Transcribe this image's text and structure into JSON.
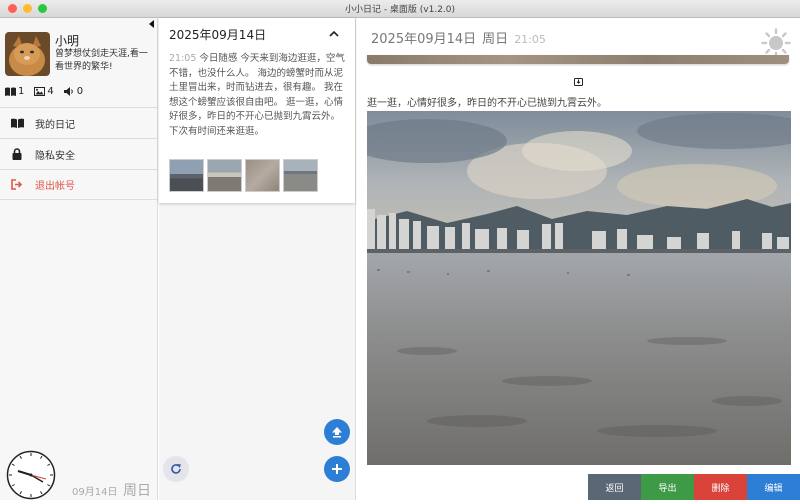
{
  "window": {
    "title": "小小日记 - 桌面版 (v1.2.0)"
  },
  "profile": {
    "name": "小明",
    "motto": "曾梦想仗剑走天涯,看一看世界的繁华!"
  },
  "stats": {
    "diaries": "1",
    "photos": "4",
    "audio": "0"
  },
  "menu": {
    "my_diary": "我的日记",
    "privacy": "隐私安全",
    "logout": "退出帐号"
  },
  "footer": {
    "date": "09月14日",
    "weekday": "周日"
  },
  "list": {
    "entry_date": "2025年09月14日",
    "entry_time": "21:05",
    "entry_text": "今日随感 今天来到海边逛逛，空气不错，也没什么人。 海边的螃蟹时而从泥土里冒出来，时而钻进去，很有趣。 我在想这个螃蟹应该很自由吧。 逛一逛，心情好很多，昨日的不开心已抛到九霄云外。 下次有时间还来逛逛。"
  },
  "detail": {
    "date": "2025年09月14日",
    "weekday": "周日",
    "time": "21:05",
    "text": "逛一逛，心情好很多，昨日的不开心已抛到九霄云外。"
  },
  "actions": {
    "back": "返回",
    "export": "导出",
    "delete": "删除",
    "edit": "编辑"
  },
  "colors": {
    "back": "#5a6774",
    "export": "#3f9a48",
    "delete": "#d9433a",
    "edit": "#2d7fd6",
    "fab": "#2d7fd6",
    "logout": "#e2574c"
  }
}
